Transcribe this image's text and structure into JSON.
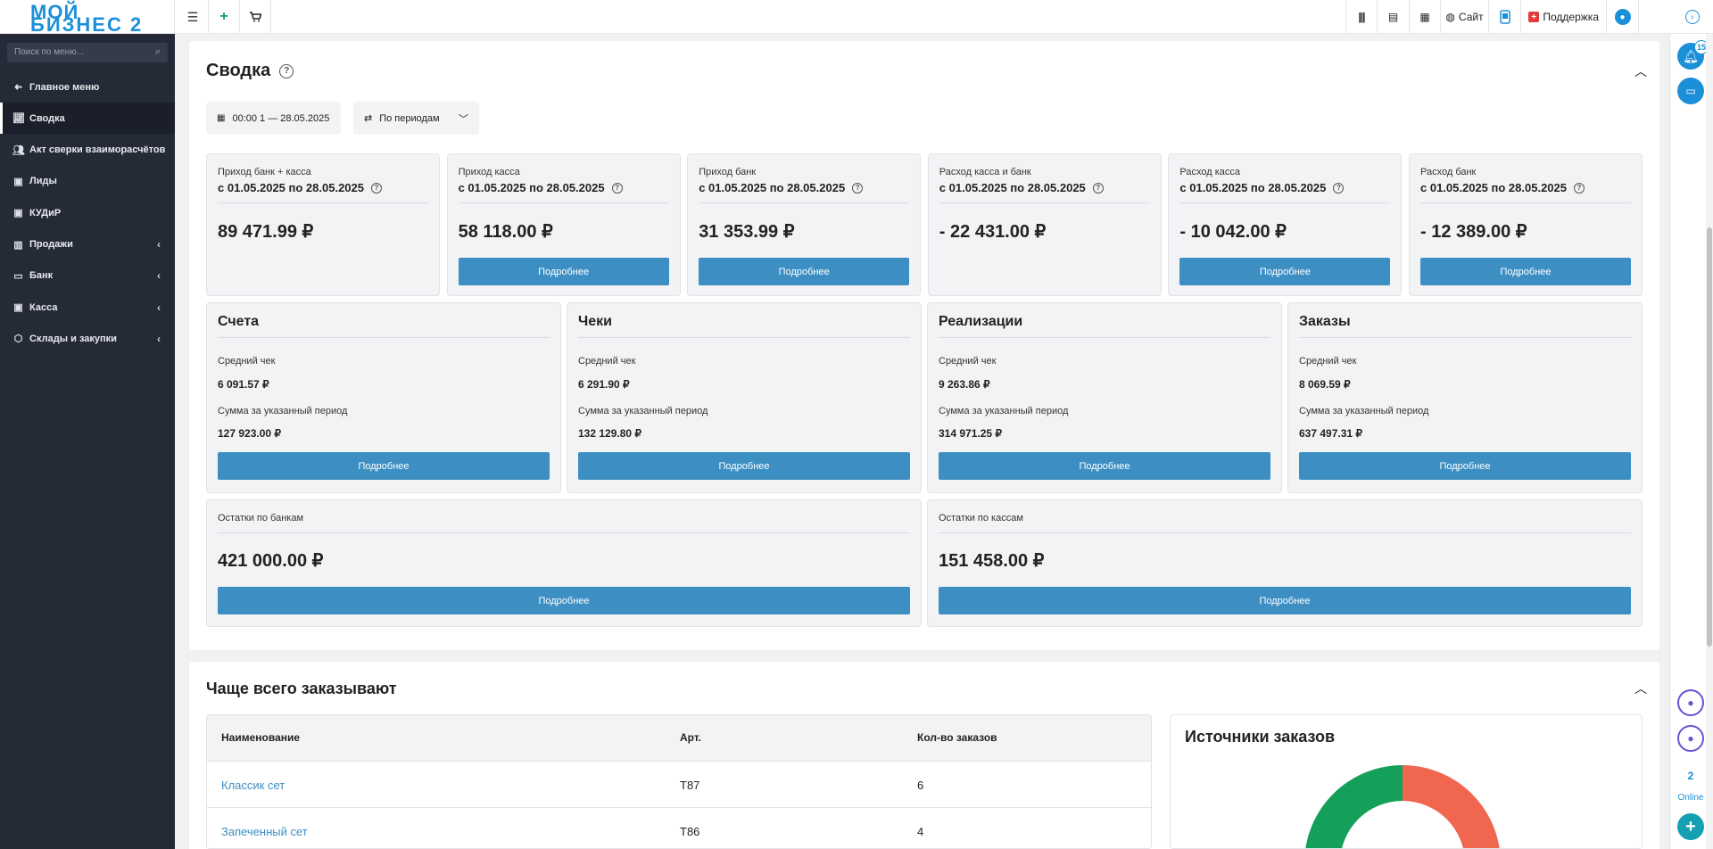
{
  "brand": {
    "line1": "МОЙ",
    "line2": "БИЗНЕС 2"
  },
  "topbar": {
    "site_label": "Сайт",
    "support_label": "Поддержка"
  },
  "sidebar": {
    "search_placeholder": "Поиск по меню...",
    "items": [
      {
        "label": "Главное меню",
        "icon": "arrow-left-icon"
      },
      {
        "label": "Сводка",
        "icon": "chart-line-icon",
        "active": true
      },
      {
        "label": "Акт сверки взаиморасчётов",
        "icon": "users-icon"
      },
      {
        "label": "Лиды",
        "icon": "bookmark-icon"
      },
      {
        "label": "КУДиР",
        "icon": "bookmark-icon"
      },
      {
        "label": "Продажи",
        "icon": "bar-chart-icon",
        "has_submenu": true
      },
      {
        "label": "Банк",
        "icon": "credit-card-icon",
        "has_submenu": true
      },
      {
        "label": "Касса",
        "icon": "cash-icon",
        "has_submenu": true
      },
      {
        "label": "Склады и закупки",
        "icon": "box-icon",
        "has_submenu": true
      }
    ]
  },
  "rail": {
    "notifications_count": "15",
    "online_count": "2",
    "online_label": "Online"
  },
  "summary": {
    "title": "Сводка",
    "date_range": "00:00 1 — 28.05.2025",
    "period_mode": "По периодам",
    "more_label": "Подробнее",
    "top_cards": [
      {
        "label": "Приход банк + касса",
        "period": "с 01.05.2025 по 28.05.2025",
        "amount": "89 471.99 ₽",
        "has_button": false
      },
      {
        "label": "Приход касса",
        "period": "с 01.05.2025 по 28.05.2025",
        "amount": "58 118.00 ₽",
        "has_button": true
      },
      {
        "label": "Приход банк",
        "period": "с 01.05.2025 по 28.05.2025",
        "amount": "31 353.99 ₽",
        "has_button": true
      },
      {
        "label": "Расход касса и банк",
        "period": "с 01.05.2025 по 28.05.2025",
        "amount": "- 22 431.00 ₽",
        "has_button": false
      },
      {
        "label": "Расход касса",
        "period": "с 01.05.2025 по 28.05.2025",
        "amount": "- 10 042.00 ₽",
        "has_button": true
      },
      {
        "label": "Расход банк",
        "period": "с 01.05.2025 по 28.05.2025",
        "amount": "- 12 389.00 ₽",
        "has_button": true
      }
    ],
    "mid_cards": [
      {
        "title": "Счета",
        "avg_label": "Средний чек",
        "avg": "6 091.57 ₽",
        "sum_label": "Сумма за указанный период",
        "sum": "127 923.00 ₽"
      },
      {
        "title": "Чеки",
        "avg_label": "Средний чек",
        "avg": "6 291.90 ₽",
        "sum_label": "Сумма за указанный период",
        "sum": "132 129.80 ₽"
      },
      {
        "title": "Реализации",
        "avg_label": "Средний чек",
        "avg": "9 263.86 ₽",
        "sum_label": "Сумма за указанный период",
        "sum": "314 971.25 ₽"
      },
      {
        "title": "Заказы",
        "avg_label": "Средний чек",
        "avg": "8 069.59 ₽",
        "sum_label": "Сумма за указанный период",
        "sum": "637 497.31 ₽"
      }
    ],
    "balance_cards": [
      {
        "label": "Остатки по банкам",
        "amount": "421 000.00 ₽"
      },
      {
        "label": "Остатки по кассам",
        "amount": "151 458.00 ₽"
      }
    ]
  },
  "popular": {
    "title": "Чаще всего заказывают",
    "columns": [
      "Наименование",
      "Арт.",
      "Кол-во заказов"
    ],
    "rows": [
      {
        "name": "Классик сет",
        "sku": "Т87",
        "count": "6"
      },
      {
        "name": "Запеченный сет",
        "sku": "Т86",
        "count": "4"
      }
    ]
  },
  "sources": {
    "title": "Источники заказов",
    "colors": {
      "green": "#14a05a",
      "red": "#f0664f"
    }
  }
}
